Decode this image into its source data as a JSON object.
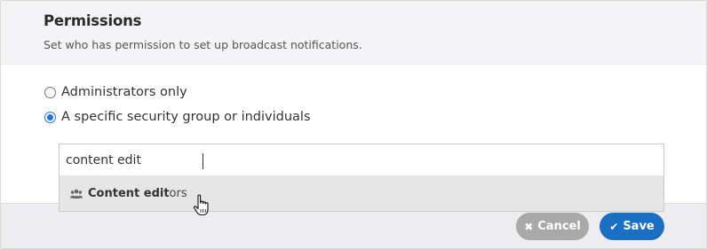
{
  "header": {
    "title": "Permissions",
    "subtitle": "Set who has permission to set up broadcast notifications."
  },
  "options": [
    {
      "label": "Administrators only",
      "checked": false
    },
    {
      "label": "A specific security group or individuals",
      "checked": true
    }
  ],
  "search": {
    "value": "content edit"
  },
  "dropdown": {
    "icon": "group-icon",
    "match": "Content edit",
    "rest": "ors"
  },
  "buttons": {
    "cancel_label": "Cancel",
    "cancel_icon": "x-icon",
    "save_label": "Save",
    "save_icon": "checkmark-icon"
  },
  "colors": {
    "accent": "#1b6fc2",
    "radio_selected": "#1a73e8",
    "cancel_bg": "#a9a9a9",
    "header_bg": "#f4f4f6",
    "footer_bg": "#ededef",
    "dropdown_highlight": "#e6e6e6"
  }
}
